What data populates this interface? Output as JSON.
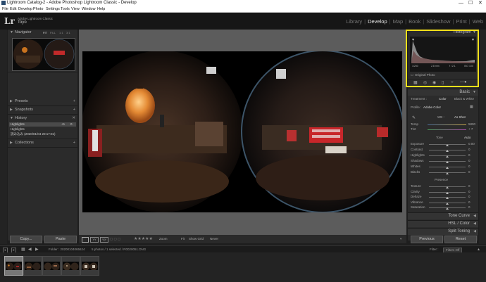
{
  "window": {
    "title": "Lightroom Catalog-2 - Adobe Photoshop Lightroom Classic - Develop",
    "controls": [
      "—",
      "☐",
      "✕"
    ]
  },
  "menu": [
    "File",
    "Edit",
    "Develop",
    "Photo",
    "Settings",
    "Tools",
    "View",
    "Window",
    "Help"
  ],
  "identity": {
    "logo": "Lr",
    "product": "Adobe Lightroom Classic",
    "user": "Toyo"
  },
  "modules": [
    "Library",
    "Develop",
    "Map",
    "Book",
    "Slideshow",
    "Print",
    "Web"
  ],
  "left_panel": {
    "navigator": {
      "label": "Navigator",
      "zoom_options": [
        "FIT",
        "FILL",
        "1:1",
        "3:1"
      ]
    },
    "presets": "Presets",
    "snapshots": "Snapshots",
    "history": {
      "label": "History",
      "items": [
        {
          "name": "Highlights",
          "value": "+1",
          "value2": "0"
        },
        {
          "name": "Highlights",
          "value": "",
          "value2": ""
        },
        {
          "name": "読み込み (2020/01/04 20:17:01)",
          "value": "",
          "value2": ""
        }
      ]
    },
    "collections": "Collections",
    "copy_label": "Copy...",
    "paste_label": "Paste"
  },
  "toolbar": {
    "rating": "★★★★★",
    "zoom_label": "Zoom",
    "zoom_value": "Fit",
    "show_grid_label": "Show Grid",
    "never_label": "Never"
  },
  "right_panel": {
    "histogram": {
      "label": "Histogram",
      "readouts": [
        "1/250",
        "2.8 mm",
        "f / 2.1",
        "ISO 100"
      ],
      "original_photo": "Original Photo"
    },
    "basic": {
      "label": "Basic",
      "treatment_label": "Treatment :",
      "treatment_options": [
        "Color",
        "Black & White"
      ],
      "profile_label": "Profile :",
      "profile_value": "Adobe Color",
      "wb_label": "WB :",
      "wb_value": "As Shot",
      "temp_label": "Temp",
      "temp_value": "5800",
      "tint_label": "Tint",
      "tint_value": "+ 7",
      "tone_label": "Tone",
      "auto_label": "Auto",
      "tone_sliders": [
        {
          "label": "Exposure",
          "value": "0.00",
          "level": 0.5
        },
        {
          "label": "Contrast",
          "value": "0",
          "level": 0.5
        },
        {
          "label": "Highlights",
          "value": "0",
          "level": 0.5
        },
        {
          "label": "Shadows",
          "value": "0",
          "level": 0.5
        },
        {
          "label": "Whites",
          "value": "0",
          "level": 0.5
        },
        {
          "label": "Blacks",
          "value": "0",
          "level": 0.5
        }
      ],
      "presence_label": "Presence",
      "presence_sliders": [
        {
          "label": "Texture",
          "value": "0",
          "level": 0.5
        },
        {
          "label": "Clarity",
          "value": "0",
          "level": 0.5
        },
        {
          "label": "Dehaze",
          "value": "0",
          "level": 0.5
        },
        {
          "label": "Vibrance",
          "value": "0",
          "level": 0.5
        },
        {
          "label": "Saturation",
          "value": "0",
          "level": 0.5
        }
      ]
    },
    "sections": [
      "Tone Curve",
      "HSL / Color",
      "Split Toning"
    ],
    "previous_label": "Previous",
    "reset_label": "Reset"
  },
  "filmstrip_bar": {
    "pages": [
      "1",
      "2"
    ],
    "folder": "Folder : 20200104065624",
    "count": "5 photos / 1 selected / R0020051.DNG",
    "filter_label": "Filter :",
    "filter_value": "Filters Off"
  },
  "filmstrip": {
    "thumbnails": 5,
    "selected_index": 0
  },
  "colors": {
    "highlight_box": "#f4e11a",
    "panel_bg": "#2b2b2b",
    "main_bg": "#5c5c5c"
  }
}
